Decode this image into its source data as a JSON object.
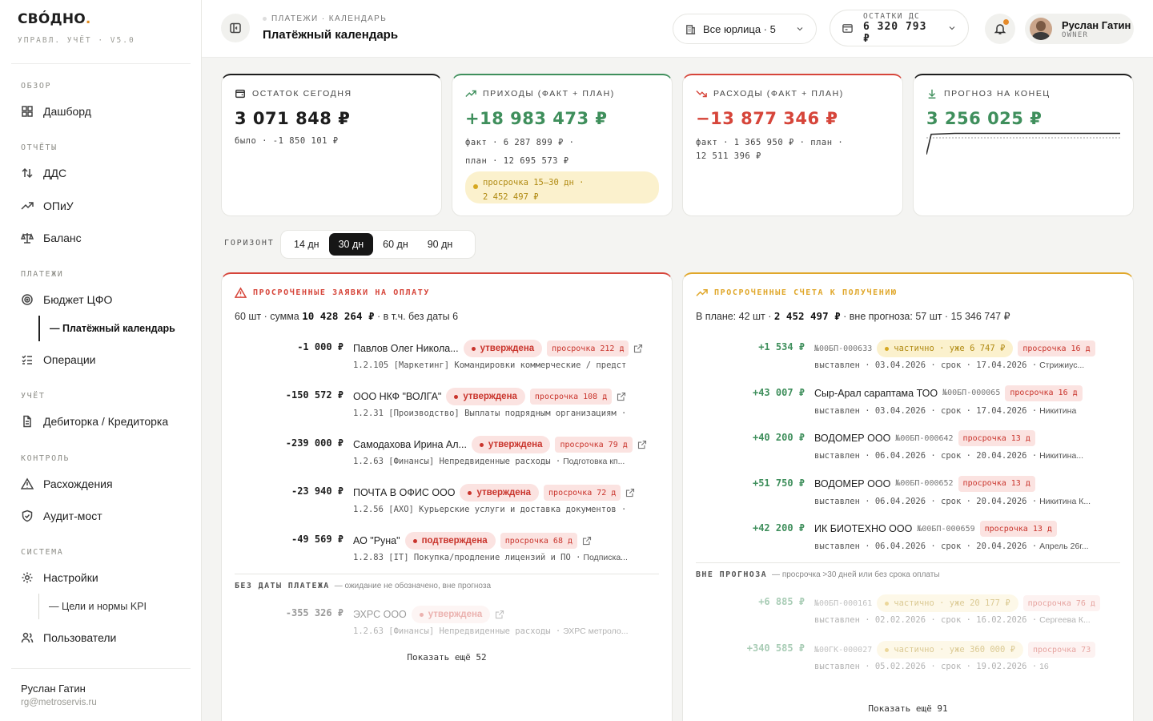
{
  "app": {
    "logo": "СВÓДНО",
    "logo_dot": ".",
    "subtitle": "УПРАВЛ. УЧЁТ · V5.0"
  },
  "sidebar": {
    "sections": {
      "overview": "ОБЗОР",
      "reports": "ОТЧЁТЫ",
      "payments": "ПЛАТЕЖИ",
      "accounting": "УЧЁТ",
      "control": "КОНТРОЛЬ",
      "system": "СИСТЕМА"
    },
    "items": {
      "dashboard": "Дашборд",
      "dds": "ДДС",
      "opiu": "ОПиУ",
      "balance": "Баланс",
      "budget": "Бюджет ЦФО",
      "calendar": "— Платёжный календарь",
      "operations": "Операции",
      "debt": "Дебиторка / Кредиторка",
      "discrepancies": "Расхождения",
      "audit": "Аудит-мост",
      "settings": "Настройки",
      "kpi": "— Цели и нормы KPI",
      "users": "Пользователи"
    },
    "user": {
      "name": "Руслан Гатин",
      "email": "rg@metroservis.ru"
    }
  },
  "topbar": {
    "breadcrumb": "ПЛАТЕЖИ · КАЛЕНДАРЬ",
    "title": "Платёжный календарь",
    "entities": "Все юрлица · 5",
    "balance_label": "ОСТАТКИ ДС",
    "balance_value": "6 320 793 ₽",
    "user_name": "Руслан Гатин",
    "user_role": "OWNER"
  },
  "kpis": {
    "today": {
      "label": "ОСТАТОК СЕГОДНЯ",
      "value": "3 071 848 ₽",
      "sub": "было · -1 850 101 ₽"
    },
    "income": {
      "label": "ПРИХОДЫ (ФАКТ + ПЛАН)",
      "value": "+18 983 473 ₽",
      "sub1": "факт · 6 287 899 ₽ ·",
      "sub2": "план · 12 695 573 ₽",
      "warn1": "просрочка 15–30 дн ·",
      "warn2": "2 452 497 ₽"
    },
    "expense": {
      "label": "РАСХОДЫ (ФАКТ + ПЛАН)",
      "value": "−13 877 346 ₽",
      "sub1": "факт · 1 365 950 ₽ · план ·",
      "sub2": "12 511 396 ₽"
    },
    "forecast": {
      "label": "ПРОГНОЗ НА КОНЕЦ",
      "value": "3 256 025 ₽"
    }
  },
  "horizon": {
    "label": "ГОРИЗОНТ",
    "tabs": [
      "14 дн",
      "30 дн",
      "60 дн",
      "90 дн"
    ],
    "active": 1
  },
  "payables": {
    "title": "ПРОСРОЧЕННЫЕ ЗАЯВКИ НА ОПЛАТУ",
    "summary_pre": "60 шт · сумма ",
    "summary_sum": "10 428 264 ₽",
    "summary_post": " · в т.ч. без даты 6",
    "rows": [
      {
        "amount": "-1 000 ₽",
        "name": "Павлов Олег Никола...",
        "status": "утверждена",
        "overdue": "просрочка 212 д",
        "code": "1.2.105 [Маркетинг] Командировки коммерческие / предст",
        "note": ""
      },
      {
        "amount": "-150 572 ₽",
        "name": "ООО НКФ \"ВОЛГА\"",
        "status": "утверждена",
        "overdue": "просрочка 108 д",
        "code": "1.2.31 [Производство] Выплаты подрядным организациям ·",
        "note": ""
      },
      {
        "amount": "-239 000 ₽",
        "name": "Самодахова Ирина Ал...",
        "status": "утверждена",
        "overdue": "просрочка 79 д",
        "code": "1.2.63 [Финансы] Непредвиденные расходы ·",
        "note": "Подготовка кп..."
      },
      {
        "amount": "-23 940 ₽",
        "name": "ПОЧТА В ОФИС ООО",
        "status": "утверждена",
        "overdue": "просрочка 72 д",
        "code": "1.2.56 [АХО] Курьерские услуги и доставка документов ·",
        "note": ""
      },
      {
        "amount": "-49 569 ₽",
        "name": "АО \"Руна\"",
        "status": "подтверждена",
        "overdue": "просрочка 68 д",
        "code": "1.2.83 [IT] Покупка/продление лицензий и ПО ·",
        "note": "Подписка..."
      }
    ],
    "nodate_title": "БЕЗ ДАТЫ ПЛАТЕЖА",
    "nodate_note": "— ожидание не обозначено, вне прогноза",
    "nodate_row": {
      "amount": "-355 326 ₽",
      "name": "ЭХРС ООО",
      "status": "утверждена",
      "code": "1.2.63 [Финансы] Непредвиденные расходы ·",
      "note": "ЭХРС метроло..."
    },
    "more": "Показать ещё 52"
  },
  "receivables": {
    "title": "ПРОСРОЧЕННЫЕ СЧЕТА К ПОЛУЧЕНИЮ",
    "summary_pre": "В плане: 42 шт · ",
    "summary_sum": "2 452 497 ₽",
    "summary_post": " · вне прогноза: 57 шт · 15 346 747 ₽",
    "rows": [
      {
        "amount": "+1 534 ₽",
        "name": "",
        "code": "№00БП-000633",
        "partial": "частично · уже 6 747 ₽",
        "overdue": "просрочка 16 д",
        "issued": "выставлен · 03.04.2026 · срок · 17.04.2026 ·",
        "note": "Стрижиус..."
      },
      {
        "amount": "+43 007 ₽",
        "name": "Сыр-Арал сарaптама ТОО",
        "code": "№00БП-000065",
        "partial": "",
        "overdue": "просрочка 16 д",
        "issued": "выставлен · 03.04.2026 · срок · 17.04.2026 ·",
        "note": "Никитина"
      },
      {
        "amount": "+40 200 ₽",
        "name": "ВОДОМЕР ООО",
        "code": "№00БП-000642",
        "partial": "",
        "overdue": "просрочка 13 д",
        "issued": "выставлен · 06.04.2026 · срок · 20.04.2026 ·",
        "note": "Никитина..."
      },
      {
        "amount": "+51 750 ₽",
        "name": "ВОДОМЕР ООО",
        "code": "№00БП-000652",
        "partial": "",
        "overdue": "просрочка 13 д",
        "issued": "выставлен · 06.04.2026 · срок · 20.04.2026 ·",
        "note": "Никитина К..."
      },
      {
        "amount": "+42 200 ₽",
        "name": "ИК БИОТЕХНО ООО",
        "code": "№00БП-000659",
        "partial": "",
        "overdue": "просрочка 13 д",
        "issued": "выставлен · 06.04.2026 · срок · 20.04.2026 ·",
        "note": "Апрель 26г..."
      }
    ],
    "outside_title": "ВНЕ ПРОГНОЗА",
    "outside_note": "— просрочка >30 дней или без срока оплаты",
    "outside_rows": [
      {
        "amount": "+6 885 ₽",
        "code": "№00БП-000161",
        "partial": "частично · уже 20 177 ₽",
        "overdue": "просрочка 76 д",
        "issued": "выставлен · 02.02.2026 · срок · 16.02.2026 ·",
        "note": "Сергеева К..."
      },
      {
        "amount": "+340 585 ₽",
        "code": "№00ГК-000027",
        "partial": "частично · уже 360 000 ₽",
        "overdue": "просрочка 73",
        "issued": "выставлен · 05.02.2026 · срок · 19.02.2026 ·",
        "note": "16"
      }
    ],
    "more": "Показать ещё 91"
  },
  "colors": {
    "green": "#3f8f5c",
    "red": "#d6453a",
    "amber": "#e0a72a",
    "dark": "#161616"
  },
  "chart_data": {
    "type": "line",
    "note": "forecast sparkline",
    "values": [
      2,
      9,
      9.3,
      9.3,
      9.3,
      9.3,
      9.3,
      9.3,
      9.3,
      9.3
    ]
  }
}
